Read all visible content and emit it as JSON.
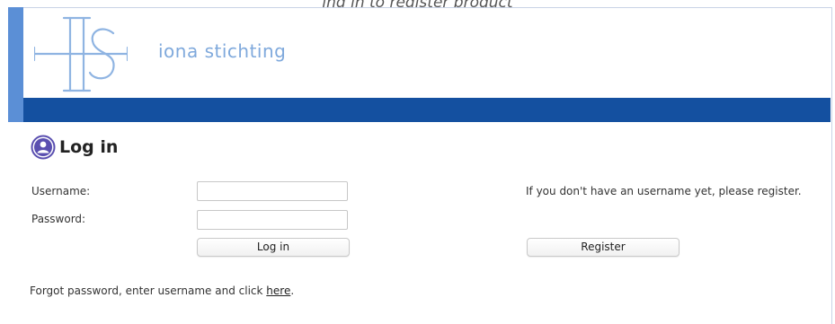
{
  "header": {
    "caption": "ing in to register product",
    "brand": "iona stichting"
  },
  "colors": {
    "header_bar": "#1450a0",
    "left_stripe": "#5b8fd6",
    "logo": "#7fa9dc",
    "icon_accent": "#5a4fb0"
  },
  "icons": {
    "logo": "iona-stichting-logo",
    "user": "user-circle-icon"
  },
  "login": {
    "title": "Log in",
    "username_label": "Username:",
    "username_value": "",
    "password_label": "Password:",
    "password_value": "",
    "login_button": "Log in"
  },
  "register": {
    "note": "If you don't have an username yet, please register.",
    "button": "Register"
  },
  "forgot": {
    "prefix": "Forgot password, enter username and click ",
    "link": "here",
    "suffix": "."
  }
}
